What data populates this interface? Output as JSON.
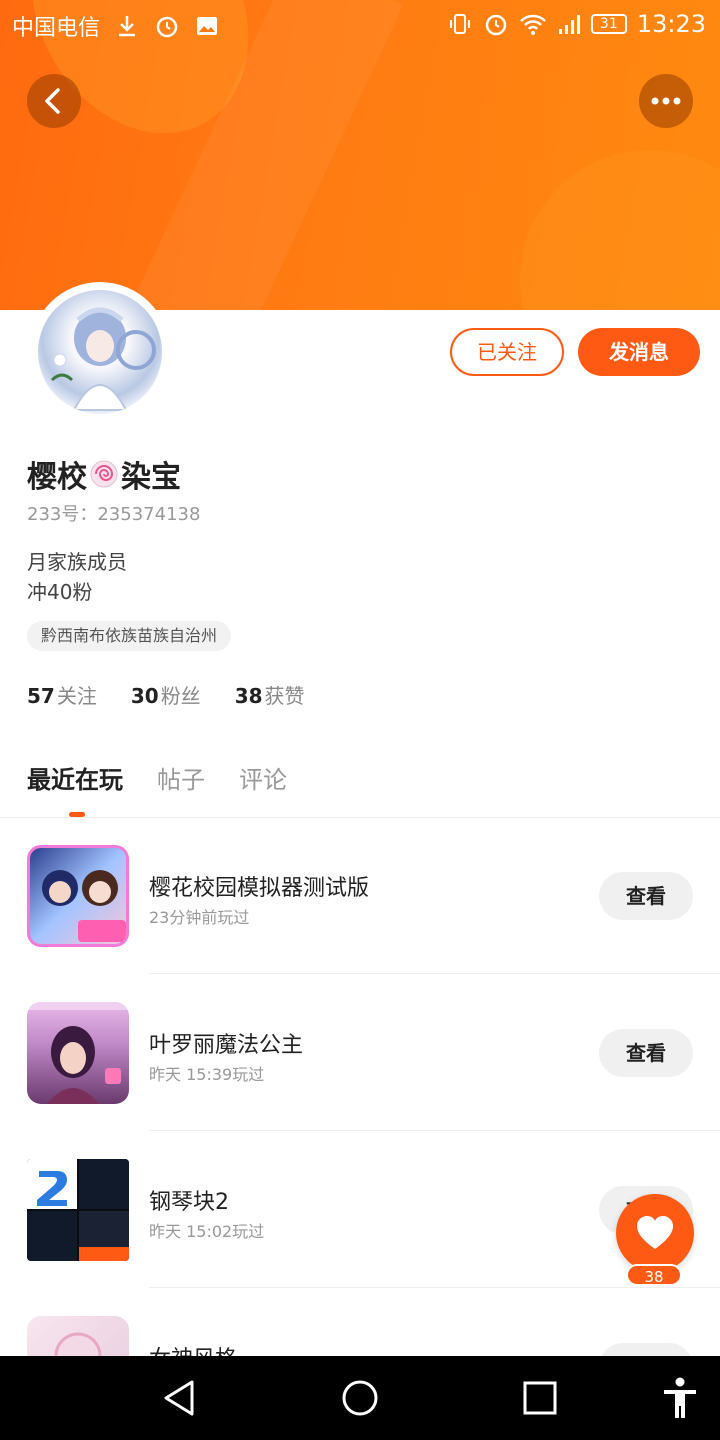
{
  "status_bar": {
    "carrier": "中国电信",
    "time": "13:23",
    "battery": "31",
    "network": "2G"
  },
  "header": {
    "back_icon": "chevron-left-icon",
    "more_icon": "more-dots-icon"
  },
  "profile": {
    "name_part1": "樱校",
    "name_part2": "染宝",
    "uid": "233号：235374138",
    "bio_line1": "月家族成员",
    "bio_line2": "冲40粉",
    "location": "黔西南布依族苗族自治州",
    "follow_button": "已关注",
    "message_button": "发消息"
  },
  "stats": [
    {
      "value": "57",
      "label": "关注"
    },
    {
      "value": "30",
      "label": "粉丝"
    },
    {
      "value": "38",
      "label": "获赞"
    }
  ],
  "tabs": [
    "最近在玩",
    "帖子",
    "评论"
  ],
  "games": [
    {
      "name": "樱花校园模拟器测试版",
      "time": "23分钟前玩过",
      "action": "查看"
    },
    {
      "name": "叶罗丽魔法公主",
      "time": "昨天 15:39玩过",
      "action": "查看"
    },
    {
      "name": "钢琴块2",
      "time": "昨天 15:02玩过",
      "action": "查看"
    },
    {
      "name": "女神风格",
      "time": "",
      "action": "查看"
    }
  ],
  "like_fab": {
    "count": "38"
  },
  "colors": {
    "accent": "#ff5a14",
    "banner": "#ff7a12"
  }
}
